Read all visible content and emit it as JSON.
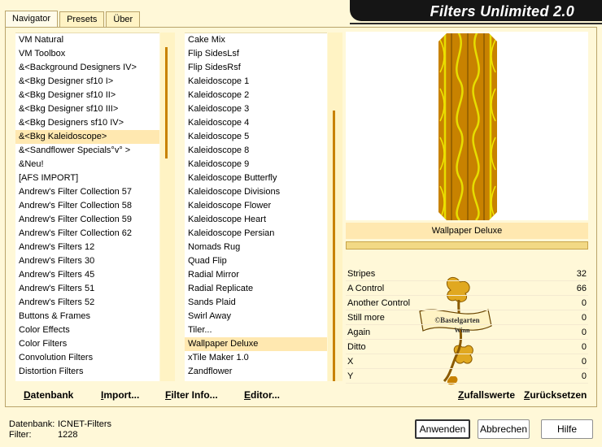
{
  "tabs": [
    {
      "label": "Navigator"
    },
    {
      "label": "Presets"
    },
    {
      "label": "Über"
    }
  ],
  "title": "Filters Unlimited 2.0",
  "categories": [
    "VM Natural",
    "VM Toolbox",
    "&<Background Designers IV>",
    "&<Bkg Designer sf10 I>",
    "&<Bkg Designer sf10 II>",
    "&<Bkg Designer sf10 III>",
    "&<Bkg Designers sf10 IV>",
    "&<Bkg Kaleidoscope>",
    "&<Sandflower Specials°v° >",
    "&Neu!",
    "[AFS IMPORT]",
    "Andrew's Filter Collection 57",
    "Andrew's Filter Collection 58",
    "Andrew's Filter Collection 59",
    "Andrew's Filter Collection 62",
    "Andrew's Filters 12",
    "Andrew's Filters 30",
    "Andrew's Filters 45",
    "Andrew's Filters 51",
    "Andrew's Filters 52",
    "Buttons & Frames",
    "Color Effects",
    "Color Filters",
    "Convolution Filters",
    "Distortion Filters"
  ],
  "categories_selected": "&<Bkg Kaleidoscope>",
  "filters": [
    "Cake Mix",
    "Flip SidesLsf",
    "Flip SidesRsf",
    "Kaleidoscope 1",
    "Kaleidoscope 2",
    "Kaleidoscope 3",
    "Kaleidoscope 4",
    "Kaleidoscope 5",
    "Kaleidoscope 8",
    "Kaleidoscope 9",
    "Kaleidoscope Butterfly",
    "Kaleidoscope Divisions",
    "Kaleidoscope Flower",
    "Kaleidoscope Heart",
    "Kaleidoscope Persian",
    "Nomads Rug",
    "Quad Flip",
    "Radial Mirror",
    "Radial Replicate",
    "Sands Plaid",
    "Swirl Away",
    "Tiler...",
    "Wallpaper Deluxe",
    "xTile Maker 1.0",
    "Zandflower"
  ],
  "filters_selected": "Wallpaper Deluxe",
  "preview_caption": "Wallpaper Deluxe",
  "params": [
    {
      "label": "Stripes",
      "value": "32"
    },
    {
      "label": "A Control",
      "value": "66"
    },
    {
      "label": "Another Control",
      "value": "0"
    },
    {
      "label": "Still more",
      "value": "0"
    },
    {
      "label": "Again",
      "value": "0"
    },
    {
      "label": "Ditto",
      "value": "0"
    },
    {
      "label": "X",
      "value": "0"
    },
    {
      "label": "Y",
      "value": "0"
    }
  ],
  "watermark": "©Bastelgarten Winn",
  "toolbar": {
    "datenbank": "Datenbank",
    "import": "Import...",
    "filter_info": "Filter Info...",
    "editor": "Editor...",
    "zufallswerte": "Zufallswerte",
    "zuruecksetzen": "Zurücksetzen"
  },
  "status": {
    "db_label": "Datenbank:",
    "db_value": "ICNET-Filters",
    "filter_label": "Filter:",
    "filter_value": "1228"
  },
  "buttons": {
    "apply": "Anwenden",
    "cancel": "Abbrechen",
    "help": "Hilfe"
  },
  "colors": {
    "background": "#fff8d8",
    "accent": "#c88200",
    "selection": "#ffe8b0",
    "banner": "#151515"
  }
}
